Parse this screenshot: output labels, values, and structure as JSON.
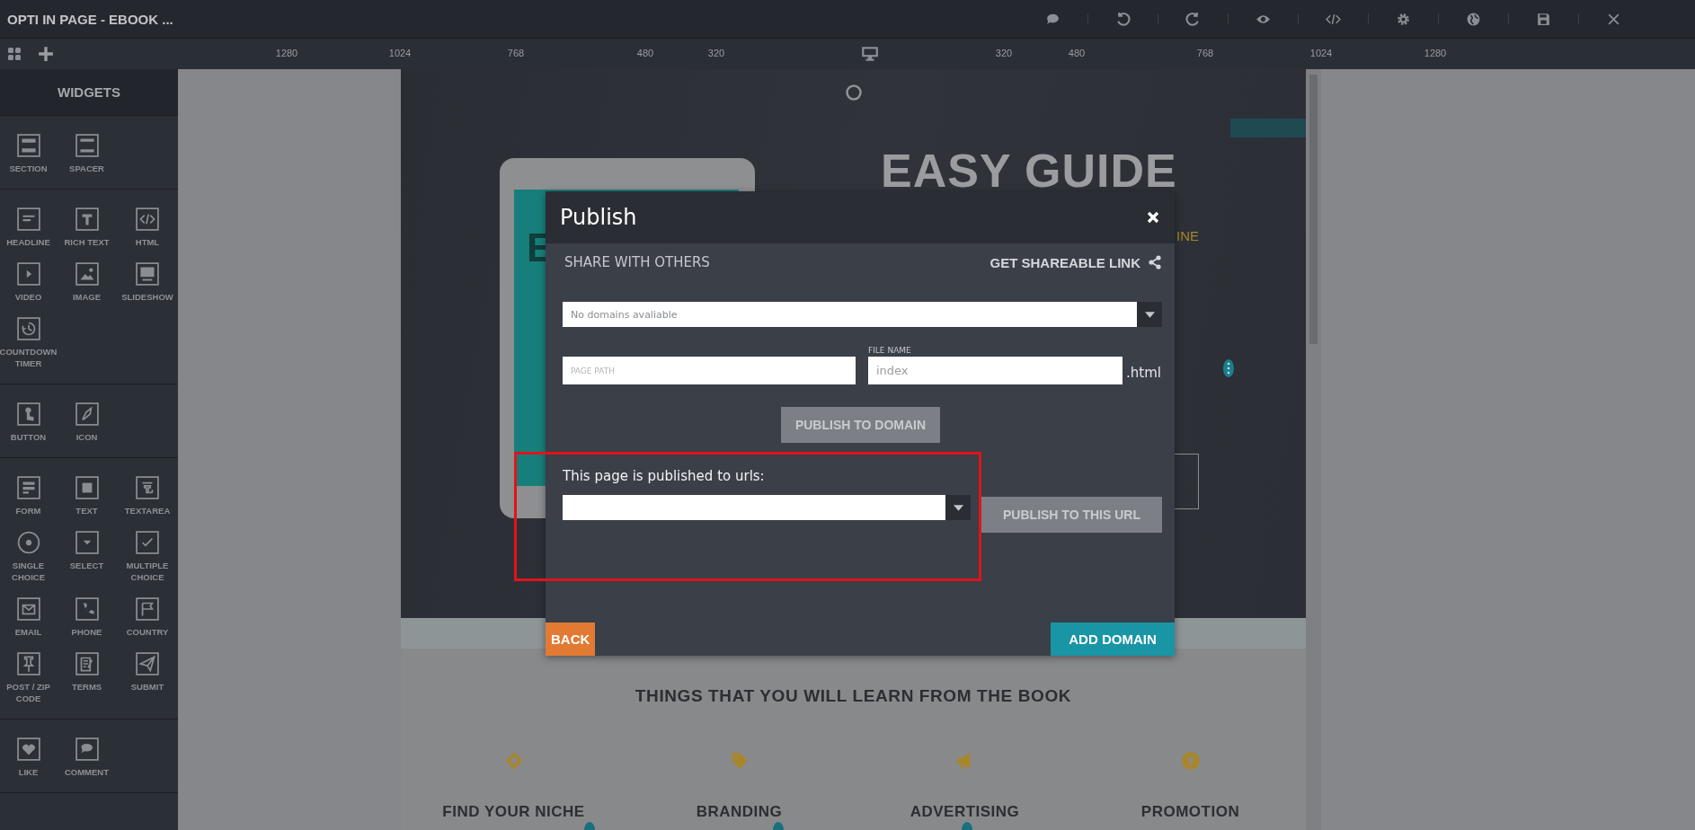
{
  "app": {
    "title": "OPTI IN PAGE - EBOOK ..."
  },
  "ruler": {
    "labels": [
      "1280",
      "1024",
      "768",
      "480",
      "320",
      "320",
      "480",
      "768",
      "1024",
      "1280"
    ]
  },
  "sidebar": {
    "title": "WIDGETS",
    "groups": [
      {
        "items": [
          {
            "label": "SECTION",
            "kind": "section"
          },
          {
            "label": "SPACER",
            "kind": "spacer"
          }
        ]
      },
      {
        "items": [
          {
            "label": "HEADLINE",
            "kind": "headline"
          },
          {
            "label": "RICH TEXT",
            "kind": "richtext"
          },
          {
            "label": "HTML",
            "kind": "html"
          },
          {
            "label": "VIDEO",
            "kind": "video"
          },
          {
            "label": "IMAGE",
            "kind": "image"
          },
          {
            "label": "SLIDESHOW",
            "kind": "slideshow"
          },
          {
            "label": "COUNTDOWN TIMER",
            "kind": "timer"
          }
        ]
      },
      {
        "items": [
          {
            "label": "BUTTON",
            "kind": "button"
          },
          {
            "label": "ICON",
            "kind": "icon"
          }
        ]
      },
      {
        "items": [
          {
            "label": "FORM",
            "kind": "form"
          },
          {
            "label": "TEXT",
            "kind": "text"
          },
          {
            "label": "TEXTAREA",
            "kind": "textarea"
          },
          {
            "label": "SINGLE CHOICE",
            "kind": "radio"
          },
          {
            "label": "SELECT",
            "kind": "select"
          },
          {
            "label": "MULTIPLE CHOICE",
            "kind": "check"
          },
          {
            "label": "EMAIL",
            "kind": "email"
          },
          {
            "label": "PHONE",
            "kind": "phone"
          },
          {
            "label": "COUNTRY",
            "kind": "flag"
          },
          {
            "label": "POST / ZIP CODE",
            "kind": "pin"
          },
          {
            "label": "TERMS",
            "kind": "terms"
          },
          {
            "label": "SUBMIT",
            "kind": "submit"
          }
        ]
      },
      {
        "items": [
          {
            "label": "LIKE",
            "kind": "like"
          },
          {
            "label": "COMMENT",
            "kind": "comment"
          }
        ]
      }
    ]
  },
  "page": {
    "hero": {
      "headline": "EASY GUIDE",
      "subline_fragment": "INE",
      "tablet_letter": "E"
    },
    "section_title": "THINGS THAT YOU WILL LEARN FROM THE BOOK",
    "features": [
      {
        "title": "FIND YOUR NICHE",
        "kind": "target"
      },
      {
        "title": "BRANDING",
        "kind": "tag"
      },
      {
        "title": "ADVERTISING",
        "kind": "megaphone"
      },
      {
        "title": "PROMOTION",
        "kind": "upload"
      }
    ]
  },
  "dialog": {
    "title": "Publish",
    "share_label": "SHARE WITH OTHERS",
    "link_action": "GET SHAREABLE LINK",
    "domain_select": {
      "placeholder": "No domains avaliable"
    },
    "page_path": {
      "placeholder": "PAGE PATH"
    },
    "file_name": {
      "label": "FILE NAME",
      "placeholder": "index",
      "suffix": ".html"
    },
    "publish_domain_button": {
      "label": "PUBLISH TO DOMAIN",
      "disabled": true
    },
    "published_label": "This page is published to urls:",
    "publish_url_button": {
      "label": "PUBLISH TO THIS URL",
      "disabled": true
    },
    "back_button": "BACK",
    "add_domain_button": "ADD DOMAIN"
  }
}
